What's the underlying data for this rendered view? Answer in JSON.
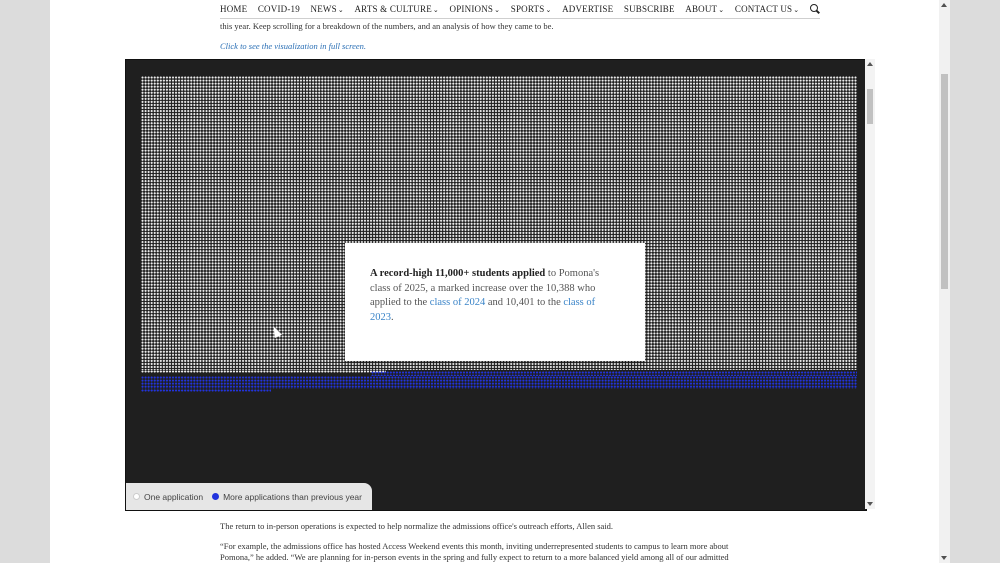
{
  "nav": {
    "items": [
      {
        "label": "HOME",
        "has_dropdown": false
      },
      {
        "label": "COVID-19",
        "has_dropdown": false
      },
      {
        "label": "NEWS",
        "has_dropdown": true
      },
      {
        "label": "ARTS & CULTURE",
        "has_dropdown": true
      },
      {
        "label": "OPINIONS",
        "has_dropdown": true
      },
      {
        "label": "SPORTS",
        "has_dropdown": true
      },
      {
        "label": "ADVERTISE",
        "has_dropdown": false
      },
      {
        "label": "SUBSCRIBE",
        "has_dropdown": false
      },
      {
        "label": "ABOUT",
        "has_dropdown": true
      },
      {
        "label": "CONTACT US",
        "has_dropdown": true
      }
    ],
    "dropdown_glyph": "⌄",
    "search_icon": "search-icon"
  },
  "article": {
    "intro_tail": "this year. Keep scrolling for a breakdown of the numbers, and an analysis of how they came to be.",
    "fullscreen_link": "Click to see the visualization in full screen.",
    "paragraph_1": "The return to in-person operations is expected to help normalize the admissions office's outreach efforts, Allen said.",
    "paragraph_2_line_1": "“For example, the admissions office has hosted Access Weekend events this month, inviting underrepresented students to campus to learn more about",
    "paragraph_2_line_2": "Pomona,” he added. “We are planning for in-person events in the spring and fully expect to return to a more balanced yield among all of our admitted"
  },
  "visualization": {
    "callout": {
      "strong": "A record-high 11,000+ students applied",
      "text_1": " to Pomona's class of 2025, a marked increase over the 10,388 who applied to the ",
      "link_1": "class of 2024",
      "text_2": " and 10,401 to the ",
      "link_2": "class of 2023",
      "text_3": "."
    },
    "legend": {
      "one_application": "One application",
      "more_applications": "More applications than previous year"
    },
    "colors": {
      "background": "#1f1f1f",
      "dot": "#ededed",
      "highlight_dot": "#2233dd",
      "link": "#3a84c8"
    }
  }
}
